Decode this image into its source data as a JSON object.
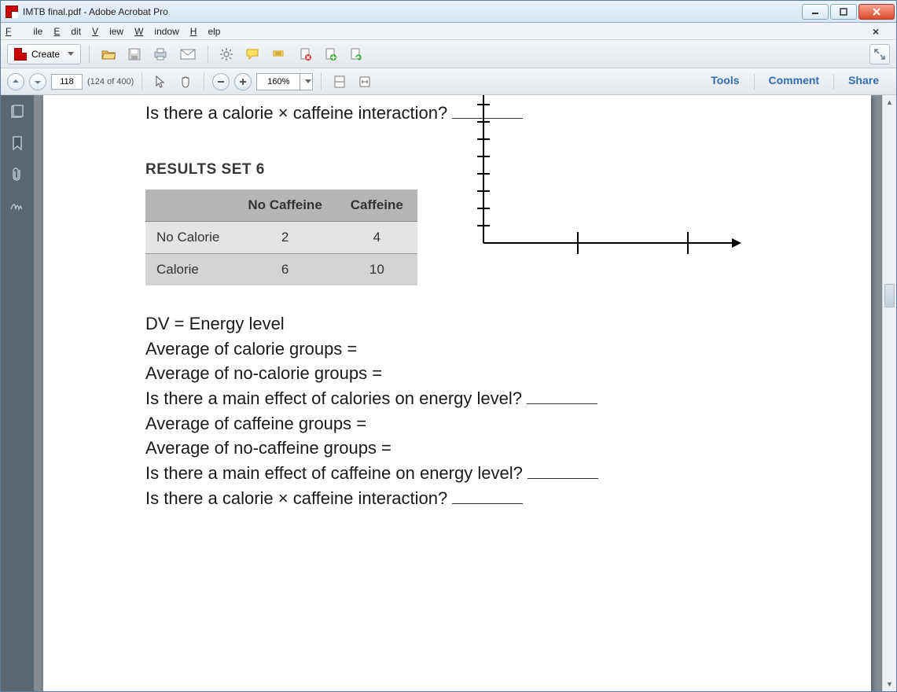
{
  "window": {
    "title": "IMTB final.pdf - Adobe Acrobat Pro"
  },
  "menu": {
    "file": "File",
    "edit": "Edit",
    "view": "View",
    "window": "Window",
    "help": "Help"
  },
  "toolbar": {
    "create": "Create"
  },
  "nav": {
    "page": "118",
    "page_of": "(124 of 400)",
    "zoom": "160%"
  },
  "panel": {
    "tools": "Tools",
    "comment": "Comment",
    "share": "Share"
  },
  "doc": {
    "top_q": "Is there a calorie × caffeine interaction?",
    "sec_title": "RESULTS SET 6",
    "th_blank": "",
    "th_nocaf": "No Caffeine",
    "th_caf": "Caffeine",
    "r1_label": "No Calorie",
    "r1_c1": "2",
    "r1_c2": "4",
    "r2_label": "Calorie",
    "r2_c1": "6",
    "r2_c2": "10",
    "l1": "DV = Energy level",
    "l2": "Average of calorie groups =",
    "l3": "Average of no-calorie groups =",
    "l4": "Is there a main effect of calories on energy level?",
    "l5": "Average of caffeine groups =",
    "l6": "Average of no-caffeine groups =",
    "l7": "Is there a main effect of caffeine on energy level?",
    "l8": "Is there a calorie × caffeine interaction?"
  },
  "chart_data": {
    "type": "table",
    "title": "RESULTS SET 6",
    "columns": [
      "",
      "No Caffeine",
      "Caffeine"
    ],
    "rows": [
      {
        "label": "No Calorie",
        "values": [
          2,
          4
        ]
      },
      {
        "label": "Calorie",
        "values": [
          6,
          10
        ]
      }
    ],
    "dv": "Energy level",
    "blank_axes": {
      "y_ticks": 10,
      "x_ticks": 2
    }
  }
}
